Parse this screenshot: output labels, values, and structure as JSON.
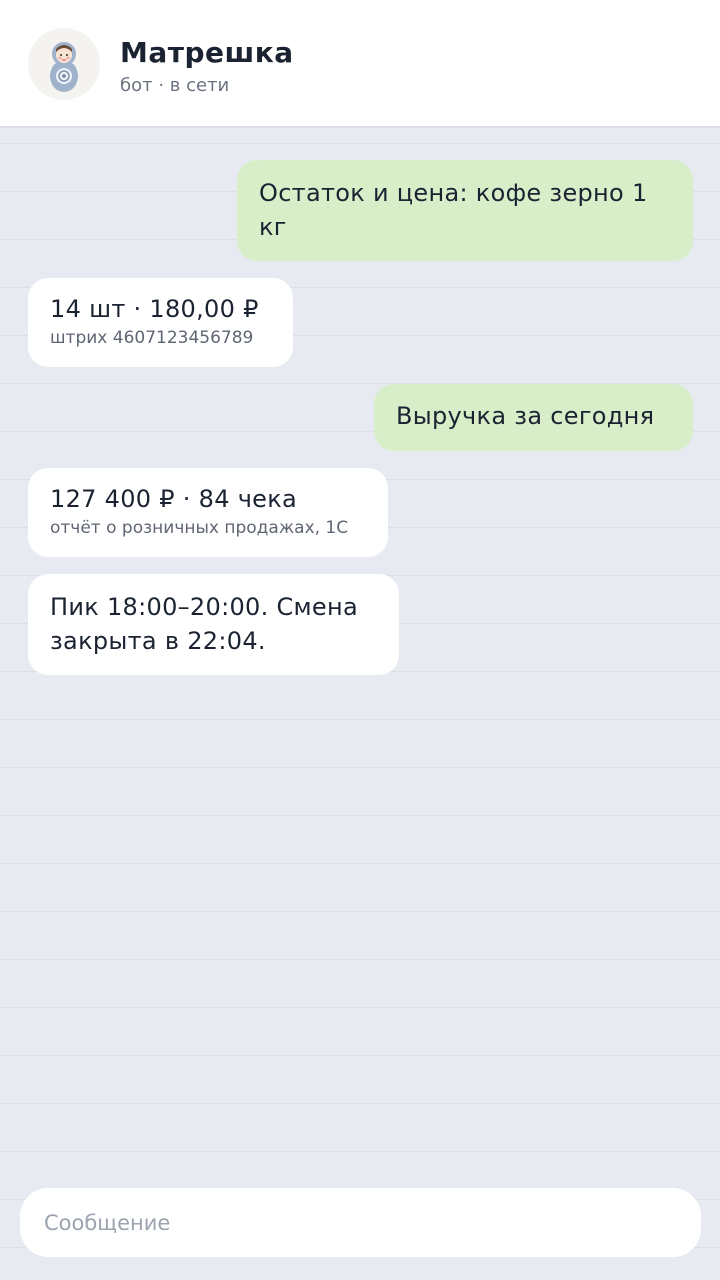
{
  "header": {
    "title": "Матрешка",
    "status": "бот · в сети",
    "avatar_icon": "matryoshka-doll-icon"
  },
  "messages": [
    {
      "direction": "outgoing",
      "text": "Остаток и цена: кофе зерно 1 кг"
    },
    {
      "direction": "incoming",
      "text": "14 шт · 180,00 ₽",
      "subtext": "штрих 4607123456789"
    },
    {
      "direction": "outgoing",
      "text": "Выручка за сегодня"
    },
    {
      "direction": "incoming",
      "text": "127 400 ₽ · 84 чека",
      "subtext": "отчёт о розничных продажах, 1С"
    },
    {
      "direction": "incoming",
      "text": "Пик 18:00–20:00. Смена закрыта в 22:04."
    }
  ],
  "composer": {
    "placeholder": "Сообщение",
    "value": ""
  },
  "colors": {
    "background": "#e7eaf1",
    "outgoing_bubble": "#d8eec8",
    "incoming_bubble": "#ffffff",
    "text": "#1b2332"
  }
}
